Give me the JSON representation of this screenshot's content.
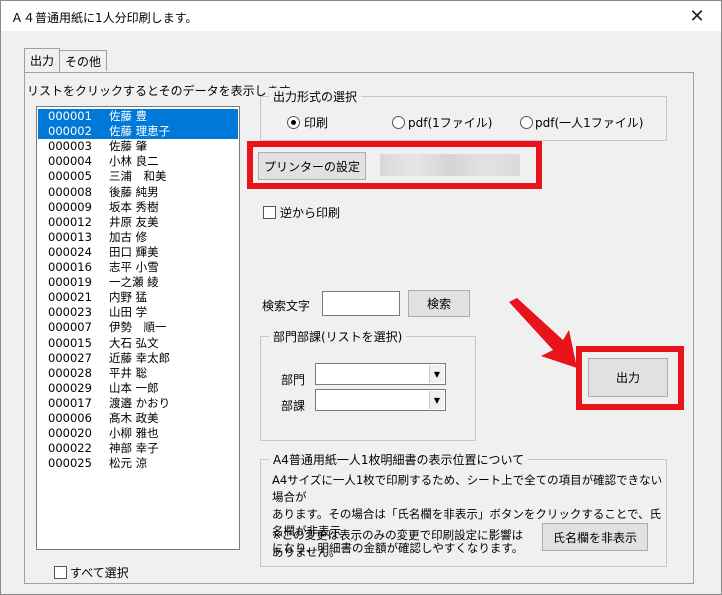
{
  "window": {
    "title": "Ａ４普通用紙に1人分印刷します。",
    "close_label": "✕"
  },
  "tabs": [
    {
      "label": "出力"
    },
    {
      "label": "その他"
    }
  ],
  "list": {
    "hint": "リストをクリックするとそのデータを表示します。",
    "items": [
      {
        "id": "000001",
        "name": "佐藤 豊",
        "selected": true
      },
      {
        "id": "000002",
        "name": "佐藤 理恵子",
        "selected": true
      },
      {
        "id": "000003",
        "name": "佐藤 肇",
        "selected": false
      },
      {
        "id": "000004",
        "name": "小林 良二",
        "selected": false
      },
      {
        "id": "000005",
        "name": "三浦　和美",
        "selected": false
      },
      {
        "id": "000008",
        "name": "後藤 純男",
        "selected": false
      },
      {
        "id": "000009",
        "name": "坂本 秀樹",
        "selected": false
      },
      {
        "id": "000012",
        "name": "井原 友美",
        "selected": false
      },
      {
        "id": "000013",
        "name": "加古 修",
        "selected": false
      },
      {
        "id": "000024",
        "name": "田口 輝美",
        "selected": false
      },
      {
        "id": "000016",
        "name": "志平 小雪",
        "selected": false
      },
      {
        "id": "000019",
        "name": "一之瀬 綾",
        "selected": false
      },
      {
        "id": "000021",
        "name": "内野 猛",
        "selected": false
      },
      {
        "id": "000023",
        "name": "山田 学",
        "selected": false
      },
      {
        "id": "000007",
        "name": "伊勢　順一",
        "selected": false
      },
      {
        "id": "000015",
        "name": "大石 弘文",
        "selected": false
      },
      {
        "id": "000027",
        "name": "近藤 幸太郎",
        "selected": false
      },
      {
        "id": "000028",
        "name": "平井 聡",
        "selected": false
      },
      {
        "id": "000029",
        "name": "山本 一郎",
        "selected": false
      },
      {
        "id": "000017",
        "name": "渡邉 かおり",
        "selected": false
      },
      {
        "id": "000006",
        "name": "髙木 政美",
        "selected": false
      },
      {
        "id": "000020",
        "name": "小柳 雅也",
        "selected": false
      },
      {
        "id": "000022",
        "name": "神部 幸子",
        "selected": false
      },
      {
        "id": "000025",
        "name": "松元 涼",
        "selected": false
      }
    ],
    "select_all_label": "すべて選択"
  },
  "output_format": {
    "title": "出力形式の選択",
    "options": [
      {
        "label": "印刷",
        "checked": true
      },
      {
        "label": "pdf(1ファイル)",
        "checked": false
      },
      {
        "label": "pdf(一人1ファイル)",
        "checked": false
      }
    ]
  },
  "printer_button_label": "プリンターの設定",
  "reverse_print_label": "逆から印刷",
  "search": {
    "label": "検索文字",
    "value": "",
    "button_label": "検索"
  },
  "dept": {
    "title": "部門部課(リストを選択)",
    "dept_label": "部門",
    "dept_value": "",
    "section_label": "部課",
    "section_value": ""
  },
  "output_button_label": "出力",
  "note": {
    "title": "A4普通用紙一人1枚明細書の表示位置について",
    "lines": [
      "A4サイズに一人1枚で印刷するため、シート上で全ての項目が確認できない場合が",
      "あります。その場合は「氏名欄を非表示」ボタンをクリックすることで、氏名欄が非表示",
      "になり、明細書の金額が確認しやすくなります。",
      "※この変更は表示のみの変更で印刷設定に影響は",
      "ありません。"
    ],
    "hide_name_button_label": "氏名欄を非表示"
  },
  "colors": {
    "highlight": "#e8131b",
    "selection": "#0078d7"
  }
}
